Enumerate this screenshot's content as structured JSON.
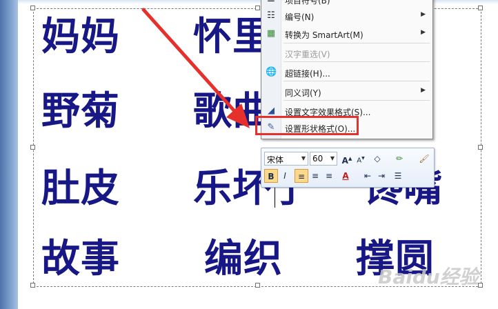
{
  "document": {
    "words": [
      "妈妈",
      "怀里",
      "野菊",
      "歌曲",
      "肚皮",
      "乐坏了",
      "馋嘴",
      "故事",
      "编织",
      "撑圆"
    ]
  },
  "context_menu": {
    "items": [
      {
        "icon": "bullets-icon",
        "label": "项目符号(B)",
        "submenu": true
      },
      {
        "icon": "numbering-icon",
        "label": "编号(N)",
        "submenu": true
      },
      {
        "icon": "smartart-icon",
        "label": "转换为 SmartArt(M)",
        "submenu": true
      },
      {
        "icon": "",
        "label": "汉字重选(V)",
        "disabled": true
      },
      {
        "icon": "hyperlink-icon",
        "label": "超链接(H)..."
      },
      {
        "icon": "",
        "label": "同义词(Y)",
        "submenu": true
      },
      {
        "icon": "text-effect-icon",
        "label": "设置文字效果格式(S)..."
      },
      {
        "icon": "shape-format-icon",
        "label": "设置形状格式(O)..."
      }
    ]
  },
  "mini_toolbar": {
    "font_name": "宋体",
    "font_size": "60",
    "bold": "B",
    "italic": "I",
    "font_color": "A"
  },
  "colors": {
    "text": "#171785",
    "highlight": "#e5302b",
    "arrow": "#e5302b"
  },
  "watermark_text": "Baidu经验"
}
